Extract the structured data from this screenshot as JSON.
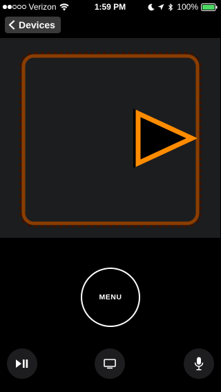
{
  "status_bar": {
    "carrier": "Verizon",
    "time": "1:59 PM",
    "battery_percent": "100%",
    "signal_bars_filled": 2,
    "signal_bars_total": 5,
    "icons": [
      "wifi-icon",
      "moon-icon",
      "location-arrow-icon",
      "bluetooth-icon",
      "battery-icon"
    ]
  },
  "nav": {
    "back_label": "Devices",
    "back_icon": "chevron-left-icon"
  },
  "touch_surface": {
    "background": "#1c1d1f",
    "swipe_indicator": "swipe-right-indicator",
    "accent_color": "#ff8c00"
  },
  "controls": {
    "menu_label": "MENU",
    "play_pause_icon": "play-pause-icon",
    "tv_icon": "tv-icon",
    "mic_icon": "microphone-icon"
  }
}
